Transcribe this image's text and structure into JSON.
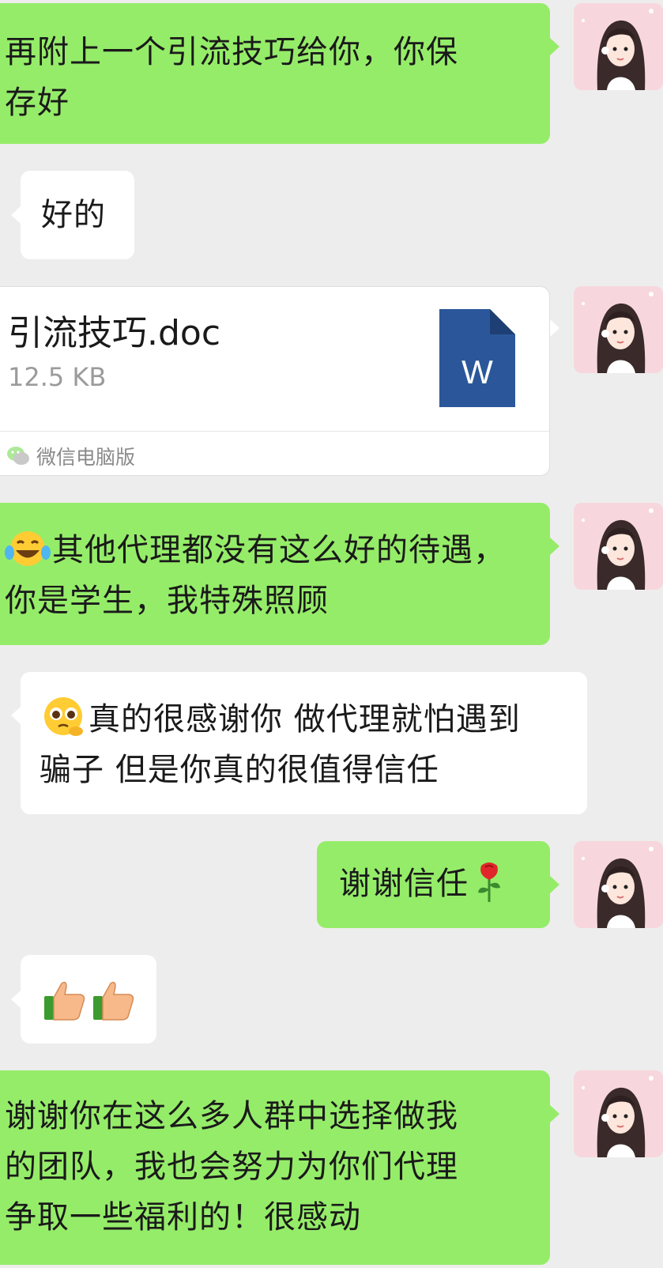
{
  "messages": {
    "m1": "再附上一个引流技巧给你，你保存好",
    "m2": "好的",
    "m4": "其他代理都没有这么好的待遇，你是学生，我特殊照顾",
    "m5": "真的很感谢你 做代理就怕遇到骗子 但是你真的很值得信任",
    "m6": "谢谢信任",
    "m8": "谢谢你在这么多人群中选择做我的团队，我也会努力为你们代理争取一些福利的！很感动"
  },
  "m1_lines": [
    "再附上一个引流技巧给你，你保",
    "存好"
  ],
  "m4_lines": [
    "其他代理都没有这么好的待遇，",
    "你是学生，我特殊照顾"
  ],
  "m5_lines": [
    "真的很感谢你 做代理就怕遇到",
    "骗子 但是你真的很值得信任"
  ],
  "m8_lines": [
    "谢谢你在这么多人群中选择做我",
    "的团队，我也会努力为你们代理",
    "争取一些福利的！很感动"
  ],
  "file": {
    "name": "引流技巧.doc",
    "size": "12.5 KB",
    "icon_letter": "W",
    "source": "微信电脑版"
  },
  "icons": {
    "m4_emoji": "tears-of-joy-emoji",
    "m5_emoji": "pleading-face-emoji",
    "m6_emoji": "rose-emoji",
    "m7_emoji": "thumbs-up-emoji"
  },
  "colors": {
    "sent_bubble": "#95ec69",
    "received_bubble": "#ffffff",
    "background": "#ededed",
    "word_icon": "#2b579a"
  }
}
